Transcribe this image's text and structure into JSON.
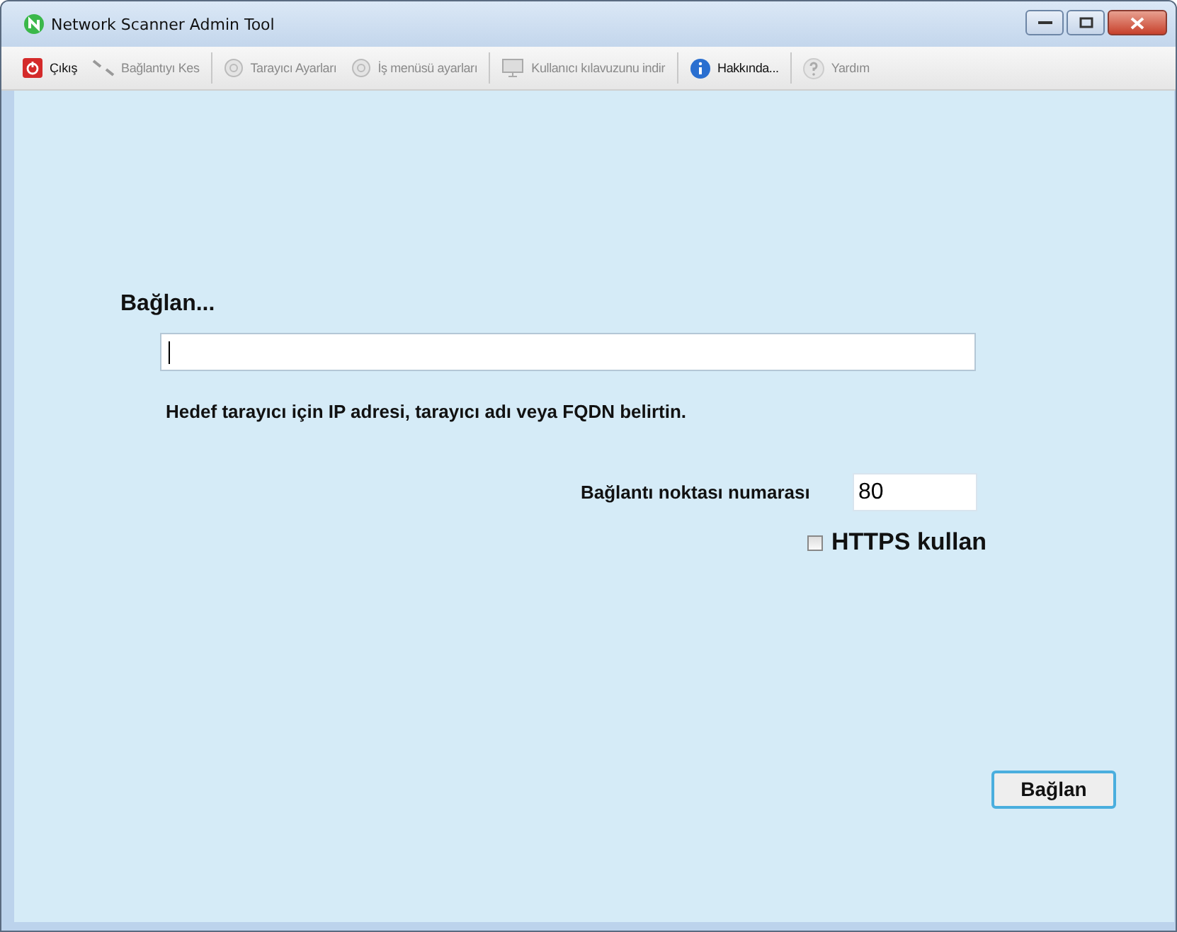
{
  "window": {
    "title": "Network Scanner Admin Tool"
  },
  "toolbar": {
    "groups": [
      [
        {
          "label": "Çıkış",
          "kind": "power",
          "disabled": false
        },
        {
          "label": "Bağlantıyı Kes",
          "kind": "disconnect",
          "disabled": true
        }
      ],
      [
        {
          "label": "Tarayıcı Ayarları",
          "kind": "gear",
          "disabled": true
        },
        {
          "label": "İş menüsü ayarları",
          "kind": "gear",
          "disabled": true
        }
      ],
      [
        {
          "label": "Kullanıcı kılavuzunu indir",
          "kind": "document",
          "disabled": true
        }
      ],
      [
        {
          "label": "Hakkında...",
          "kind": "info",
          "disabled": false
        }
      ],
      [
        {
          "label": "Yardım",
          "kind": "help",
          "disabled": true
        }
      ]
    ]
  },
  "connect": {
    "heading": "Bağlan...",
    "hint": "Hedef tarayıcı için IP adresi, tarayıcı adı veya FQDN belirtin.",
    "port": {
      "label": "Bağlantı noktası numarası",
      "value": "80"
    },
    "https": {
      "label": "HTTPS kullan",
      "checked": false
    },
    "button": "Bağlan"
  }
}
